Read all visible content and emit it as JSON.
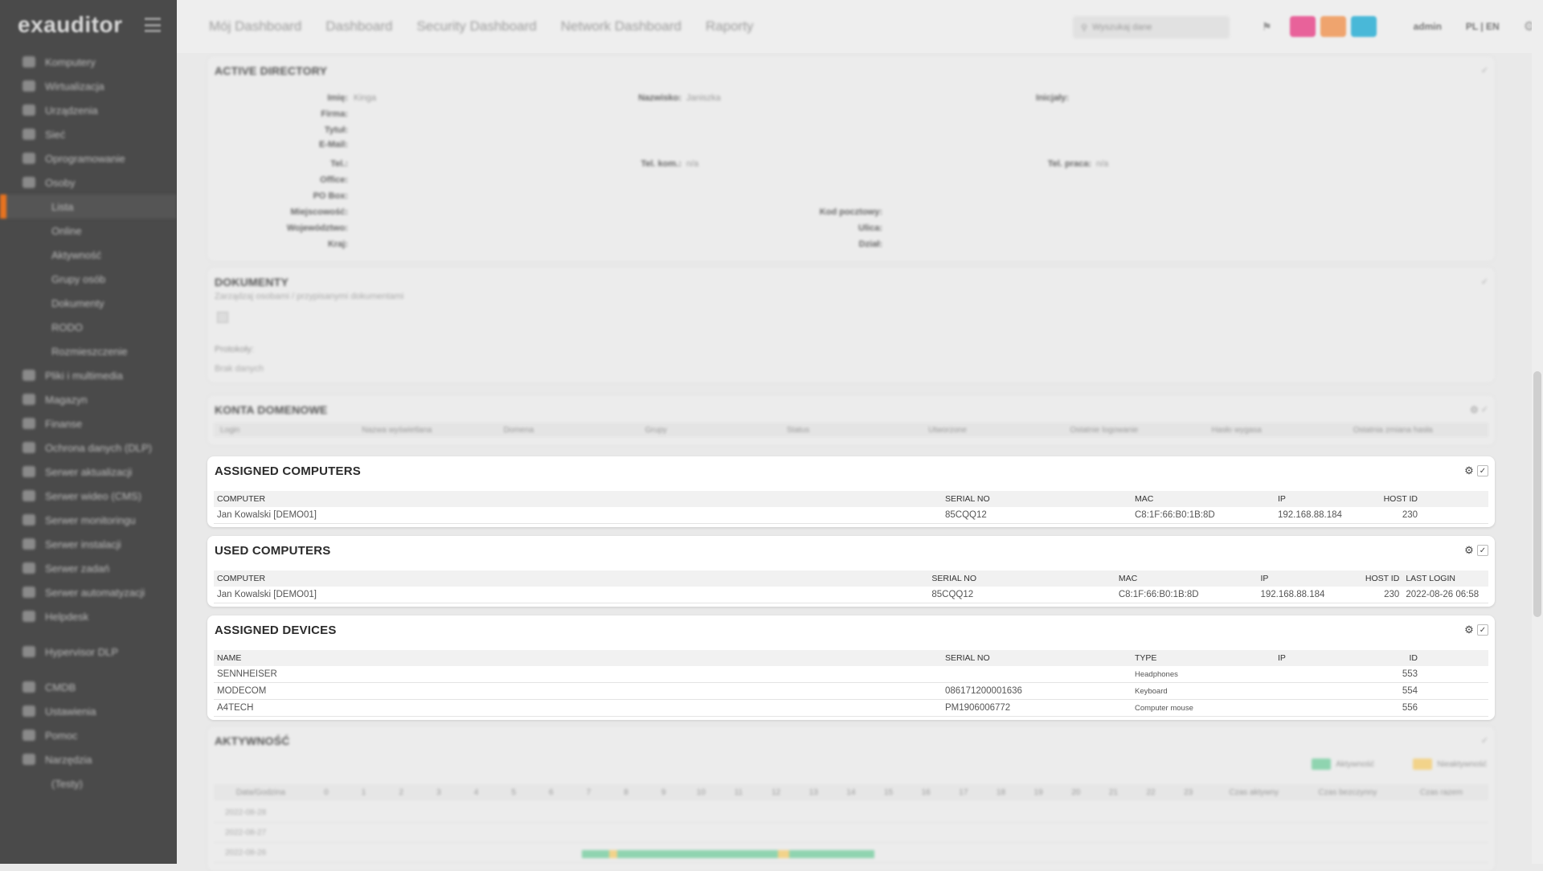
{
  "app": {
    "logo": "exauditor"
  },
  "sidebar": {
    "items": [
      {
        "label": "Komputery",
        "level": 0
      },
      {
        "label": "Wirtualizacja",
        "level": 0
      },
      {
        "label": "Urządzenia",
        "level": 0
      },
      {
        "label": "Sieć",
        "level": 0
      },
      {
        "label": "Oprogramowanie",
        "level": 0
      },
      {
        "label": "Osoby",
        "level": 0
      },
      {
        "label": "Lista",
        "level": 1,
        "active": true
      },
      {
        "label": "Online",
        "level": 1
      },
      {
        "label": "Aktywność",
        "level": 1
      },
      {
        "label": "Grupy osób",
        "level": 1
      },
      {
        "label": "Dokumenty",
        "level": 1
      },
      {
        "label": "RODO",
        "level": 1
      },
      {
        "label": "Rozmieszczenie",
        "level": 1
      },
      {
        "label": "Pliki i multimedia",
        "level": 0
      },
      {
        "label": "Magazyn",
        "level": 0
      },
      {
        "label": "Finanse",
        "level": 0
      },
      {
        "label": "Ochrona danych (DLP)",
        "level": 0
      },
      {
        "label": "Serwer aktualizacji",
        "level": 0
      },
      {
        "label": "Serwer wideo (CMS)",
        "level": 0
      },
      {
        "label": "Serwer monitoringu",
        "level": 0
      },
      {
        "label": "Serwer instalacji",
        "level": 0
      },
      {
        "label": "Serwer zadań",
        "level": 0
      },
      {
        "label": "Serwer automatyzacji",
        "level": 0
      },
      {
        "label": "Helpdesk",
        "level": 0
      },
      {
        "label": "Hypervisor DLP",
        "level": 0,
        "gap": true
      },
      {
        "label": "CMDB",
        "level": 0,
        "gap": true
      },
      {
        "label": "Ustawienia",
        "level": 0
      },
      {
        "label": "Pomoc",
        "level": 0
      },
      {
        "label": "Narzędzia",
        "level": 0
      },
      {
        "label": "(Testy)",
        "level": 1
      }
    ]
  },
  "topbar": {
    "nav": [
      "Mój Dashboard",
      "Dashboard",
      "Security Dashboard",
      "Network Dashboard",
      "Raporty"
    ],
    "search_placeholder": "Wyszukaj dane",
    "user": "admin",
    "lang": "PL | EN",
    "colors": {
      "btn1": "#e8629a",
      "btn2": "#efa46e",
      "btn3": "#49b8d8"
    }
  },
  "active_directory": {
    "title": "ACTIVE DIRECTORY",
    "fields_left": [
      {
        "label": "Imię:",
        "value": "Kinga"
      },
      {
        "label": "Firma:",
        "value": ""
      },
      {
        "label": "Tytuł:",
        "value": ""
      },
      {
        "label": "E-Mail:",
        "value": ""
      },
      {
        "label": "Tel.:",
        "value": ""
      },
      {
        "label": "Office:",
        "value": ""
      },
      {
        "label": "PO Box:",
        "value": ""
      },
      {
        "label": "Miejscowość:",
        "value": ""
      },
      {
        "label": "Województwo:",
        "value": ""
      },
      {
        "label": "Kraj:",
        "value": ""
      }
    ],
    "name2_label": "Nazwisko:",
    "name2_value": "Janiszka",
    "initials_label": "Inicjały:",
    "mobile_label": "Tel. kom.:",
    "mobile_value": "n/a",
    "work_label": "Tel. praca:",
    "work_value": "n/a",
    "postal_label": "Kod pocztowy:",
    "street_label": "Ulica:",
    "dept_label": "Dział:"
  },
  "documents": {
    "title": "DOKUMENTY",
    "subtitle": "Zarządzaj osobami / przypisanymi dokumentami",
    "protocols_label": "Protokoły:",
    "protocols_value": "Brak danych"
  },
  "domain_accounts": {
    "title": "KONTA DOMENOWE",
    "columns": [
      "Login",
      "Nazwa wyświetlana",
      "Domena",
      "Grupy",
      "Status",
      "Utworzone",
      "Ostatnie logowanie",
      "Hasło wygasa",
      "Ostatnia zmiana hasła"
    ]
  },
  "assigned_computers": {
    "title": "ASSIGNED COMPUTERS",
    "columns": [
      "COMPUTER",
      "SERIAL NO",
      "MAC",
      "IP",
      "HOST ID"
    ],
    "rows": [
      [
        "Jan Kowalski [DEMO01]",
        "85CQQ12",
        "C8:1F:66:B0:1B:8D",
        "192.168.88.184",
        "230"
      ]
    ]
  },
  "used_computers": {
    "title": "USED COMPUTERS",
    "columns": [
      "COMPUTER",
      "SERIAL NO",
      "MAC",
      "IP",
      "HOST ID",
      "LAST LOGIN"
    ],
    "rows": [
      [
        "Jan Kowalski [DEMO01]",
        "85CQQ12",
        "C8:1F:66:B0:1B:8D",
        "192.168.88.184",
        "230",
        "2022-08-26 06:58"
      ]
    ]
  },
  "assigned_devices": {
    "title": "ASSIGNED DEVICES",
    "columns": [
      "NAME",
      "SERIAL NO",
      "TYPE",
      "IP",
      "ID"
    ],
    "rows": [
      [
        "SENNHEISER",
        "",
        "Headphones",
        "",
        "553"
      ],
      [
        "MODECOM",
        "086171200001636",
        "Keyboard",
        "",
        "554"
      ],
      [
        "A4TECH",
        "PM1906006772",
        "Computer mouse",
        "",
        "556"
      ]
    ]
  },
  "activity": {
    "title": "AKTYWNOŚĆ",
    "legend_active": "Aktywność",
    "legend_inactive": "Nieaktywność",
    "colors": {
      "active": "#8fd4b0",
      "inactive": "#f2d38a"
    },
    "columns": [
      "Data/Godzina",
      "0",
      "1",
      "2",
      "3",
      "4",
      "5",
      "6",
      "7",
      "8",
      "9",
      "10",
      "11",
      "12",
      "13",
      "14",
      "15",
      "16",
      "17",
      "18",
      "19",
      "20",
      "21",
      "22",
      "23",
      "Czas aktywny",
      "Czas bezczynny",
      "Czas razem"
    ],
    "rows": [
      "2022-08-28",
      "2022-08-27",
      "2022-08-26"
    ]
  }
}
